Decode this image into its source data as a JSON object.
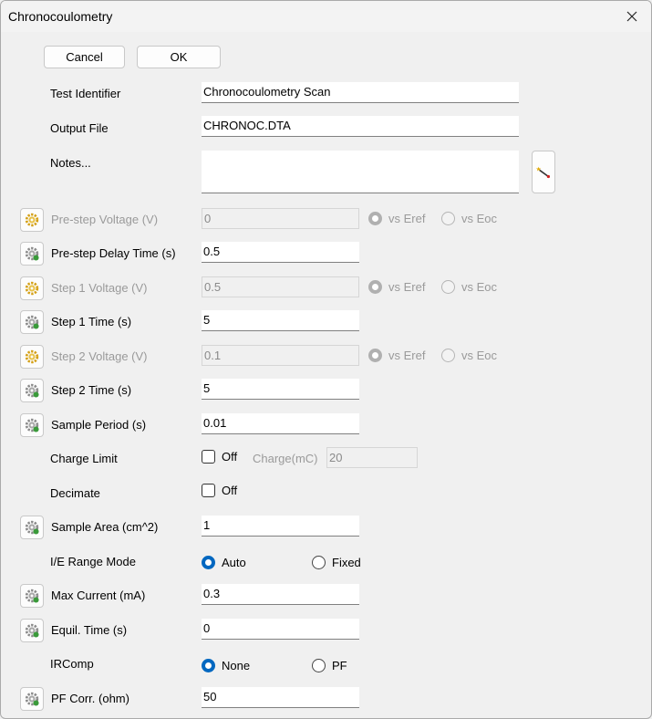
{
  "window": {
    "title": "Chronocoulometry"
  },
  "buttons": {
    "cancel": "Cancel",
    "ok": "OK"
  },
  "fields": {
    "test_identifier": {
      "label": "Test Identifier",
      "value": "Chronocoulometry Scan"
    },
    "output_file": {
      "label": "Output File",
      "value": "CHRONOC.DTA"
    },
    "notes": {
      "label": "Notes...",
      "value": ""
    },
    "prestep_voltage": {
      "label": "Pre-step Voltage (V)",
      "value": "0"
    },
    "prestep_delay": {
      "label": "Pre-step Delay Time (s)",
      "value": "0.5"
    },
    "step1_voltage": {
      "label": "Step 1 Voltage (V)",
      "value": "0.5"
    },
    "step1_time": {
      "label": "Step 1 Time (s)",
      "value": "5"
    },
    "step2_voltage": {
      "label": "Step 2 Voltage (V)",
      "value": "0.1"
    },
    "step2_time": {
      "label": "Step 2 Time (s)",
      "value": "5"
    },
    "sample_period": {
      "label": "Sample Period (s)",
      "value": "0.01"
    },
    "charge_limit": {
      "label": "Charge Limit",
      "checkbox": "Off",
      "sub_label": "Charge(mC)",
      "value": "20"
    },
    "decimate": {
      "label": "Decimate",
      "checkbox": "Off"
    },
    "sample_area": {
      "label": "Sample Area (cm^2)",
      "value": "1"
    },
    "ie_range_mode": {
      "label": "I/E Range Mode",
      "option_auto": "Auto",
      "option_fixed": "Fixed",
      "selected": "Auto"
    },
    "max_current": {
      "label": "Max Current (mA)",
      "value": "0.3"
    },
    "equil_time": {
      "label": "Equil. Time (s)",
      "value": "0"
    },
    "ircomp": {
      "label": "IRComp",
      "option_none": "None",
      "option_pf": "PF",
      "selected": "None"
    },
    "pf_corr": {
      "label": "PF Corr. (ohm)",
      "value": "50"
    }
  },
  "vs_options": {
    "eref": "vs Eref",
    "eoc": "vs Eoc"
  },
  "colors": {
    "accent": "#0067c0",
    "disabled_text": "#9a9a9a"
  },
  "icons": {
    "settings": "gear-icon",
    "notes": "wand-icon",
    "close": "close-icon"
  }
}
